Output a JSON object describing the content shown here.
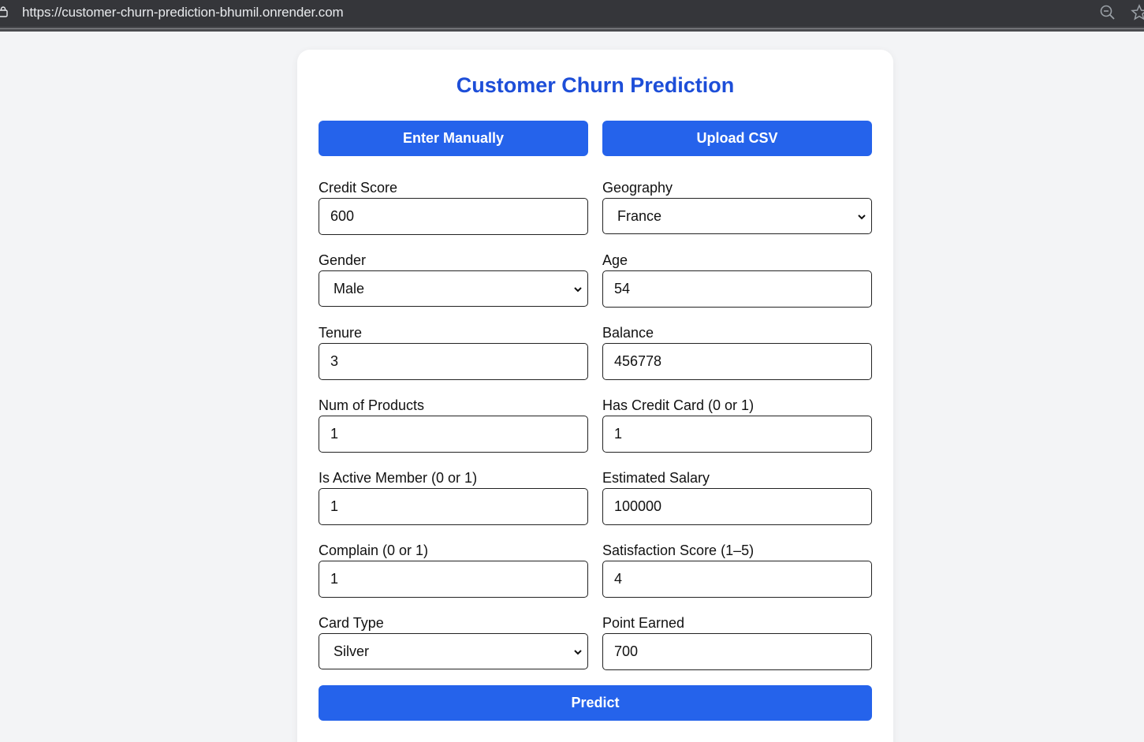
{
  "browser": {
    "url": "https://customer-churn-prediction-bhumil.onrender.com"
  },
  "page": {
    "title": "Customer Churn Prediction",
    "mode_buttons": {
      "manual": "Enter Manually",
      "csv": "Upload CSV"
    },
    "fields": {
      "credit_score": {
        "label": "Credit Score",
        "value": "600"
      },
      "geography": {
        "label": "Geography",
        "value": "France"
      },
      "gender": {
        "label": "Gender",
        "value": "Male"
      },
      "age": {
        "label": "Age",
        "value": "54"
      },
      "tenure": {
        "label": "Tenure",
        "value": "3"
      },
      "balance": {
        "label": "Balance",
        "value": "456778"
      },
      "num_products": {
        "label": "Num of Products",
        "value": "1"
      },
      "has_credit_card": {
        "label": "Has Credit Card (0 or 1)",
        "value": "1"
      },
      "is_active_member": {
        "label": "Is Active Member (0 or 1)",
        "value": "1"
      },
      "estimated_salary": {
        "label": "Estimated Salary",
        "value": "100000"
      },
      "complain": {
        "label": "Complain (0 or 1)",
        "value": "1"
      },
      "satisfaction_score": {
        "label": "Satisfaction Score (1–5)",
        "value": "4"
      },
      "card_type": {
        "label": "Card Type",
        "value": "Silver"
      },
      "point_earned": {
        "label": "Point Earned",
        "value": "700"
      }
    },
    "predict_label": "Predict"
  },
  "colors": {
    "primary": "#2563eb",
    "title": "#1d4ed8",
    "background": "#f3f4f6"
  }
}
